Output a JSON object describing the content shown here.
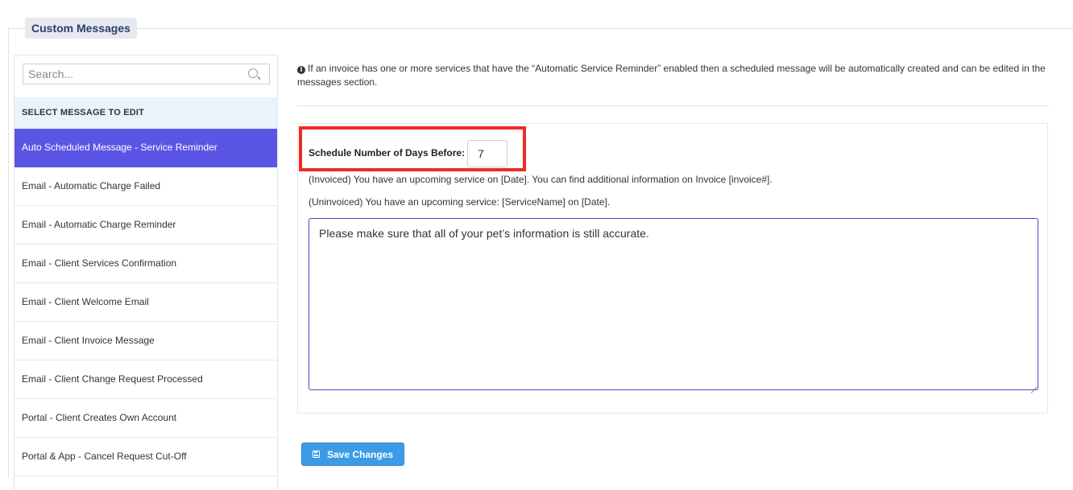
{
  "fieldset": {
    "legend": "Custom Messages"
  },
  "sidebar": {
    "search": {
      "placeholder": "Search...",
      "value": ""
    },
    "header": "SELECT MESSAGE TO EDIT",
    "items": [
      {
        "label": "Auto Scheduled Message - Service Reminder",
        "active": true
      },
      {
        "label": "Email - Automatic Charge Failed"
      },
      {
        "label": "Email - Automatic Charge Reminder"
      },
      {
        "label": "Email - Client Services Confirmation"
      },
      {
        "label": "Email - Client Welcome Email"
      },
      {
        "label": "Email - Client Invoice Message"
      },
      {
        "label": "Email - Client Change Request Processed"
      },
      {
        "label": "Portal - Client Creates Own Account"
      },
      {
        "label": "Portal & App - Cancel Request Cut-Off"
      }
    ]
  },
  "main": {
    "info_text": "If an invoice has one or more services that have the “Automatic Service Reminder” enabled then a scheduled message will be automatically created and can be edited in the messages section.",
    "days_label": "Schedule Number of Days Before:",
    "days_value": "7",
    "template_invoiced": "(Invoiced) You have an upcoming service on [Date]. You can find additional information on Invoice [invoice#].",
    "template_uninvoiced": "(Uninvoiced) You have an upcoming service: [ServiceName] on [Date].",
    "message_body": "Please make sure that all of your pet’s information is still accurate.",
    "save_label": "Save Changes"
  },
  "colors": {
    "accent": "#5b55e6",
    "highlight_border": "#ee2b24",
    "save_button": "#3b9be6",
    "header_bg": "#e8f3fb"
  },
  "icons": {
    "search": "search-icon",
    "info": "info-icon",
    "save": "floppy-disk-icon"
  }
}
